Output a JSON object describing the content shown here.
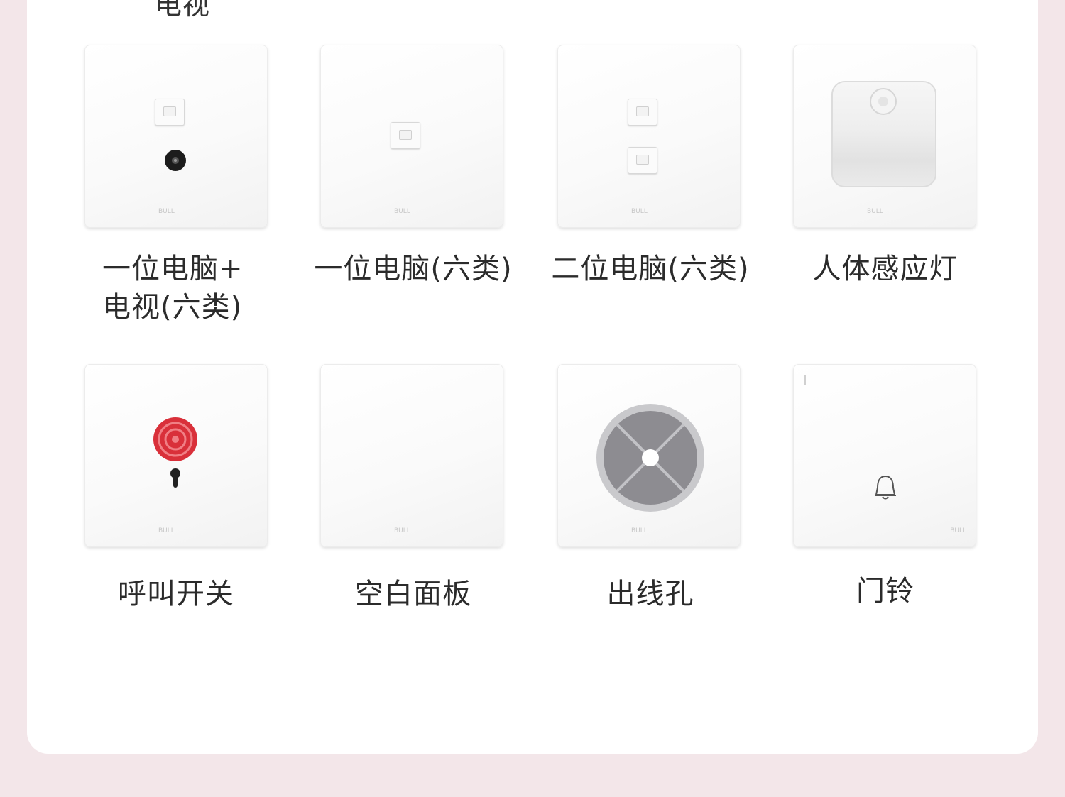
{
  "top_partial_label": "电视",
  "brand_mark": "BULL",
  "products": [
    {
      "line1": "一位电脑+",
      "line2": "电视(六类)",
      "icon": "computer-tv-socket-icon"
    },
    {
      "line1": "一位电脑(六类)",
      "line2": "",
      "icon": "single-computer-socket-icon"
    },
    {
      "line1": "二位电脑(六类)",
      "line2": "",
      "icon": "double-computer-socket-icon"
    },
    {
      "line1": "人体感应灯",
      "line2": "",
      "icon": "motion-sensor-light-icon"
    },
    {
      "line1": "呼叫开关",
      "line2": "",
      "icon": "call-switch-icon"
    },
    {
      "line1": "空白面板",
      "line2": "",
      "icon": "blank-panel-icon"
    },
    {
      "line1": "出线孔",
      "line2": "",
      "icon": "cable-outlet-icon"
    },
    {
      "line1": "门铃",
      "line2": "",
      "icon": "doorbell-icon"
    }
  ],
  "colors": {
    "background": "#f3e6e9",
    "card": "#ffffff",
    "call_button_red": "#d9303a",
    "outlet_grey": "#8d8c91"
  }
}
